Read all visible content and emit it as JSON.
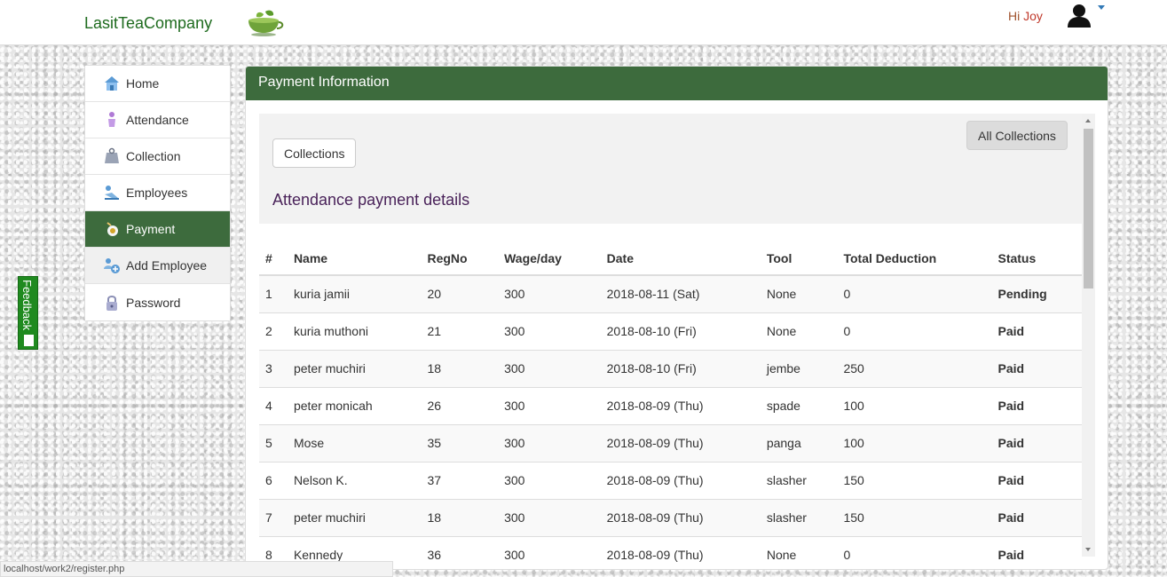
{
  "navbar": {
    "brand": "LasitTeaCompany",
    "greeting": "Hi",
    "user_name": "Joy"
  },
  "sidebar": {
    "items": [
      {
        "label": "Home",
        "icon": "home-icon"
      },
      {
        "label": "Attendance",
        "icon": "attendance-icon"
      },
      {
        "label": "Collection",
        "icon": "collection-icon"
      },
      {
        "label": "Employees",
        "icon": "employees-icon"
      },
      {
        "label": "Payment",
        "icon": "payment-icon",
        "active": true
      },
      {
        "label": "Add Employee",
        "icon": "add-employee-icon"
      },
      {
        "label": "Password",
        "icon": "lock-icon"
      }
    ]
  },
  "feedback": {
    "label": "Feedback"
  },
  "panel": {
    "title": "Payment Information",
    "collections_button": "Collections",
    "all_collections_button": "All Collections",
    "section_title": "Attendance payment details"
  },
  "table": {
    "headers": [
      "#",
      "Name",
      "RegNo",
      "Wage/day",
      "Date",
      "Tool",
      "Total Deduction",
      "Status"
    ],
    "rows": [
      [
        "1",
        "kuria jamii",
        "20",
        "300",
        "2018-08-11 (Sat)",
        "None",
        "0",
        "Pending"
      ],
      [
        "2",
        "kuria muthoni",
        "21",
        "300",
        "2018-08-10 (Fri)",
        "None",
        "0",
        "Paid"
      ],
      [
        "3",
        "peter muchiri",
        "18",
        "300",
        "2018-08-10 (Fri)",
        "jembe",
        "250",
        "Paid"
      ],
      [
        "4",
        "peter monicah",
        "26",
        "300",
        "2018-08-09 (Thu)",
        "spade",
        "100",
        "Paid"
      ],
      [
        "5",
        "Mose",
        "35",
        "300",
        "2018-08-09 (Thu)",
        "panga",
        "100",
        "Paid"
      ],
      [
        "6",
        "Nelson K.",
        "37",
        "300",
        "2018-08-09 (Thu)",
        "slasher",
        "150",
        "Paid"
      ],
      [
        "7",
        "peter muchiri",
        "18",
        "300",
        "2018-08-09 (Thu)",
        "slasher",
        "150",
        "Paid"
      ],
      [
        "8",
        "Kennedy",
        "36",
        "300",
        "2018-08-09 (Thu)",
        "None",
        "0",
        "Paid"
      ]
    ]
  },
  "statusbar": {
    "url": "localhost/work2/register.php"
  },
  "colors": {
    "brand_green": "#3d6b3d",
    "paid": "#1e7a1e",
    "pending": "#6b1010",
    "feedback": "#1f8a1f"
  }
}
